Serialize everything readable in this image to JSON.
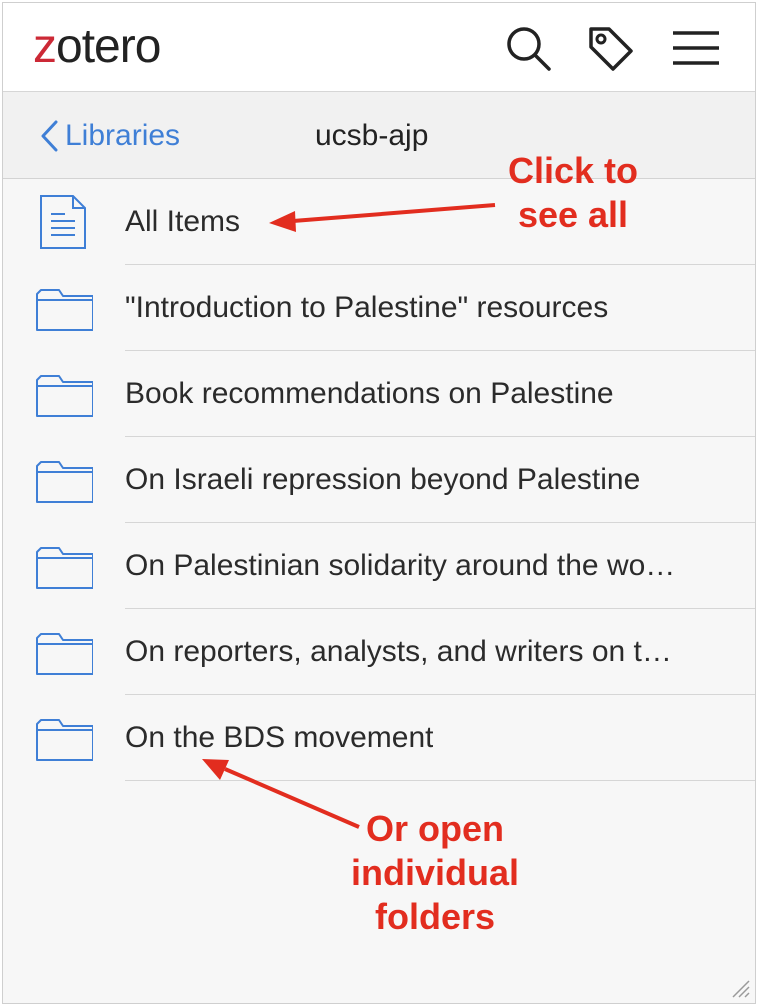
{
  "app": {
    "logo_z": "z",
    "logo_rest": "otero",
    "brand_color": "#cc2936",
    "accent_color": "#3f7fd6"
  },
  "toolbar": {
    "icons": [
      "search-icon",
      "tag-icon",
      "menu-icon"
    ]
  },
  "nav": {
    "back_label": "Libraries",
    "title": "ucsb-ajp"
  },
  "items": [
    {
      "label": "All Items",
      "icon": "document-icon"
    },
    {
      "label": "\"Introduction to Palestine\" resources",
      "icon": "folder-icon"
    },
    {
      "label": "Book recommendations on Palestine",
      "icon": "folder-icon"
    },
    {
      "label": "On Israeli repression beyond Palestine",
      "icon": "folder-icon"
    },
    {
      "label": "On Palestinian solidarity around the wo…",
      "icon": "folder-icon"
    },
    {
      "label": "On reporters, analysts, and writers on t…",
      "icon": "folder-icon"
    },
    {
      "label": "On the BDS movement",
      "icon": "folder-icon"
    }
  ],
  "annotations": {
    "top_line1": "Click to",
    "top_line2": "see all",
    "bottom_line1": "Or open",
    "bottom_line2": "individual",
    "bottom_line3": "folders",
    "color": "#e22d1f"
  }
}
